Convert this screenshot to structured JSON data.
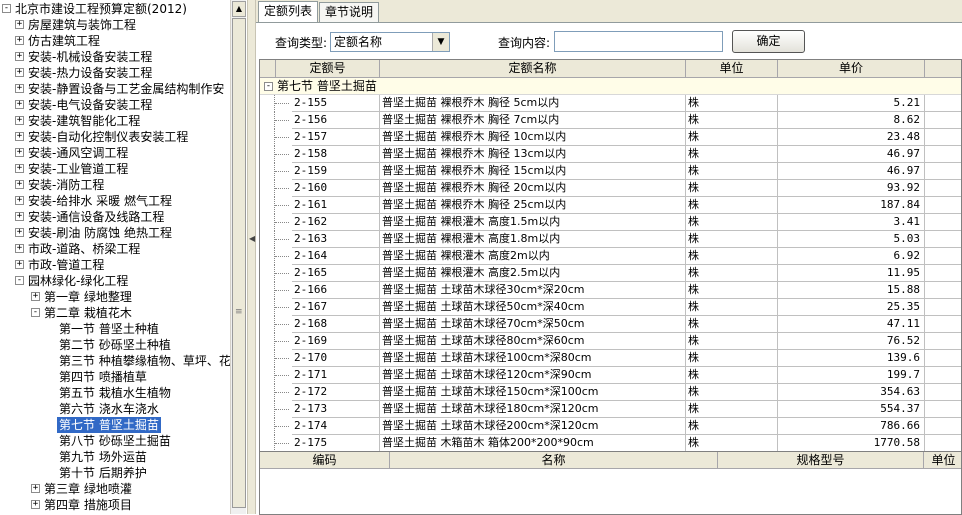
{
  "tree": {
    "root": "北京市建设工程预算定额(2012)",
    "items": [
      {
        "label": "房屋建筑与装饰工程",
        "level": 1,
        "expander": "+"
      },
      {
        "label": "仿古建筑工程",
        "level": 1,
        "expander": "+"
      },
      {
        "label": "安装-机械设备安装工程",
        "level": 1,
        "expander": "+"
      },
      {
        "label": "安装-热力设备安装工程",
        "level": 1,
        "expander": "+"
      },
      {
        "label": "安装-静置设备与工艺金属结构制作安",
        "level": 1,
        "expander": "+"
      },
      {
        "label": "安装-电气设备安装工程",
        "level": 1,
        "expander": "+"
      },
      {
        "label": "安装-建筑智能化工程",
        "level": 1,
        "expander": "+"
      },
      {
        "label": "安装-自动化控制仪表安装工程",
        "level": 1,
        "expander": "+"
      },
      {
        "label": "安装-通风空调工程",
        "level": 1,
        "expander": "+"
      },
      {
        "label": "安装-工业管道工程",
        "level": 1,
        "expander": "+"
      },
      {
        "label": "安装-消防工程",
        "level": 1,
        "expander": "+"
      },
      {
        "label": "安装-给排水 采暖 燃气工程",
        "level": 1,
        "expander": "+"
      },
      {
        "label": "安装-通信设备及线路工程",
        "level": 1,
        "expander": "+"
      },
      {
        "label": "安装-刷油 防腐蚀 绝热工程",
        "level": 1,
        "expander": "+"
      },
      {
        "label": "市政-道路、桥梁工程",
        "level": 1,
        "expander": "+"
      },
      {
        "label": "市政-管道工程",
        "level": 1,
        "expander": "+"
      },
      {
        "label": "园林绿化-绿化工程",
        "level": 1,
        "expander": "-"
      },
      {
        "label": "第一章 绿地整理",
        "level": 2,
        "expander": "+"
      },
      {
        "label": "第二章 栽植花木",
        "level": 2,
        "expander": "-"
      },
      {
        "label": "第一节 普坚土种植",
        "level": 3,
        "expander": ""
      },
      {
        "label": "第二节 砂砾坚土种植",
        "level": 3,
        "expander": ""
      },
      {
        "label": "第三节 种植攀缘植物、草坪、花",
        "level": 3,
        "expander": ""
      },
      {
        "label": "第四节 喷播植草",
        "level": 3,
        "expander": ""
      },
      {
        "label": "第五节 栽植水生植物",
        "level": 3,
        "expander": ""
      },
      {
        "label": "第六节 浇水车浇水",
        "level": 3,
        "expander": ""
      },
      {
        "label": "第七节 普坚土掘苗",
        "level": 3,
        "expander": "",
        "selected": true
      },
      {
        "label": "第八节 砂砾坚土掘苗",
        "level": 3,
        "expander": ""
      },
      {
        "label": "第九节 场外运苗",
        "level": 3,
        "expander": ""
      },
      {
        "label": "第十节 后期养护",
        "level": 3,
        "expander": ""
      },
      {
        "label": "第三章 绿地喷灌",
        "level": 2,
        "expander": "+"
      },
      {
        "label": "第四章 措施项目",
        "level": 2,
        "expander": "+"
      }
    ]
  },
  "tabs": [
    {
      "label": "定额列表",
      "active": true
    },
    {
      "label": "章节说明",
      "active": false
    }
  ],
  "query": {
    "type_label": "查询类型:",
    "type_value": "定额名称",
    "content_label": "查询内容:",
    "content_value": "",
    "ok_label": "确定"
  },
  "grid": {
    "columns": [
      "定额号",
      "定额名称",
      "单位",
      "单价"
    ],
    "group": "第七节 普坚土掘苗",
    "rows": [
      {
        "code": "2-155",
        "name": "普坚土掘苗 裸根乔木 胸径 5cm以内",
        "unit": "株",
        "price": "5.21"
      },
      {
        "code": "2-156",
        "name": "普坚土掘苗 裸根乔木 胸径 7cm以内",
        "unit": "株",
        "price": "8.62"
      },
      {
        "code": "2-157",
        "name": "普坚土掘苗 裸根乔木 胸径 10cm以内",
        "unit": "株",
        "price": "23.48"
      },
      {
        "code": "2-158",
        "name": "普坚土掘苗 裸根乔木 胸径 13cm以内",
        "unit": "株",
        "price": "46.97"
      },
      {
        "code": "2-159",
        "name": "普坚土掘苗 裸根乔木 胸径 15cm以内",
        "unit": "株",
        "price": "46.97"
      },
      {
        "code": "2-160",
        "name": "普坚土掘苗 裸根乔木 胸径 20cm以内",
        "unit": "株",
        "price": "93.92"
      },
      {
        "code": "2-161",
        "name": "普坚土掘苗 裸根乔木 胸径 25cm以内",
        "unit": "株",
        "price": "187.84"
      },
      {
        "code": "2-162",
        "name": "普坚土掘苗 裸根灌木 高度1.5m以内",
        "unit": "株",
        "price": "3.41"
      },
      {
        "code": "2-163",
        "name": "普坚土掘苗 裸根灌木 高度1.8m以内",
        "unit": "株",
        "price": "5.03"
      },
      {
        "code": "2-164",
        "name": "普坚土掘苗 裸根灌木 高度2m以内",
        "unit": "株",
        "price": "6.92"
      },
      {
        "code": "2-165",
        "name": "普坚土掘苗 裸根灌木 高度2.5m以内",
        "unit": "株",
        "price": "11.95"
      },
      {
        "code": "2-166",
        "name": "普坚土掘苗 土球苗木球径30cm*深20cm",
        "unit": "株",
        "price": "15.88"
      },
      {
        "code": "2-167",
        "name": "普坚土掘苗 土球苗木球径50cm*深40cm",
        "unit": "株",
        "price": "25.35"
      },
      {
        "code": "2-168",
        "name": "普坚土掘苗 土球苗木球径70cm*深50cm",
        "unit": "株",
        "price": "47.11"
      },
      {
        "code": "2-169",
        "name": "普坚土掘苗 土球苗木球径80cm*深60cm",
        "unit": "株",
        "price": "76.52"
      },
      {
        "code": "2-170",
        "name": "普坚土掘苗 土球苗木球径100cm*深80cm",
        "unit": "株",
        "price": "139.6"
      },
      {
        "code": "2-171",
        "name": "普坚土掘苗 土球苗木球径120cm*深90cm",
        "unit": "株",
        "price": "199.7"
      },
      {
        "code": "2-172",
        "name": "普坚土掘苗 土球苗木球径150cm*深100cm",
        "unit": "株",
        "price": "354.63"
      },
      {
        "code": "2-173",
        "name": "普坚土掘苗 土球苗木球径180cm*深120cm",
        "unit": "株",
        "price": "554.37"
      },
      {
        "code": "2-174",
        "name": "普坚土掘苗 土球苗木球径200cm*深120cm",
        "unit": "株",
        "price": "786.66"
      },
      {
        "code": "2-175",
        "name": "普坚土掘苗 木箱苗木 箱体200*200*90cm",
        "unit": "株",
        "price": "1770.58"
      }
    ]
  },
  "detail_grid": {
    "columns": [
      "编码",
      "名称",
      "规格型号",
      "单位"
    ]
  }
}
